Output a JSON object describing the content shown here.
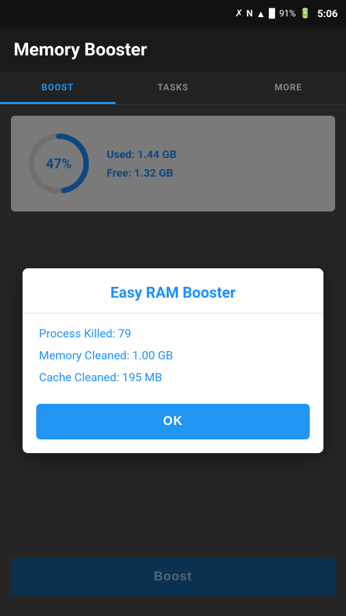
{
  "statusBar": {
    "battery": "91%",
    "time": "5:06",
    "signal": "N"
  },
  "header": {
    "title": "Memory Booster"
  },
  "tabs": [
    {
      "label": "BOOST",
      "active": true
    },
    {
      "label": "TASKS",
      "active": false
    },
    {
      "label": "MORE",
      "active": false
    }
  ],
  "memoryCard": {
    "percentage": "47%",
    "usedLabel": "Used:",
    "usedValue": "1.44 GB",
    "freeLabel": "Free:",
    "freeValue": "1.32 GB"
  },
  "boostButton": {
    "label": "Boost"
  },
  "dialog": {
    "title": "Easy RAM Booster",
    "stats": [
      {
        "label": "Process Killed:",
        "value": "79"
      },
      {
        "label": "Memory Cleaned:",
        "value": "1.00 GB"
      },
      {
        "label": "Cache Cleaned:",
        "value": "195 MB"
      }
    ],
    "okLabel": "OK"
  }
}
